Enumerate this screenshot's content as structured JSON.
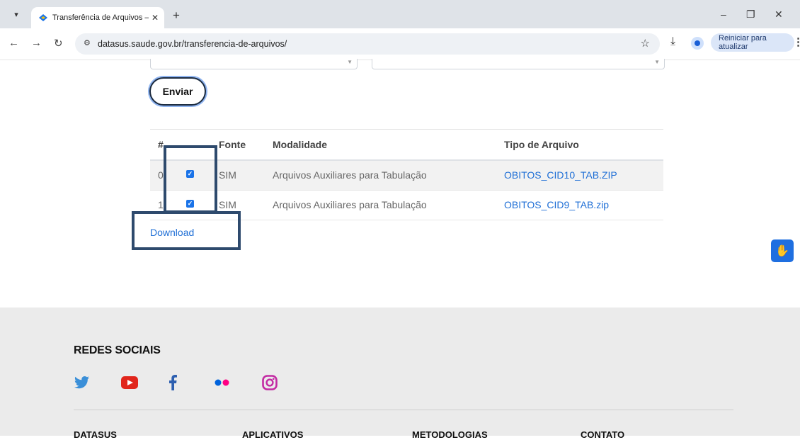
{
  "browser": {
    "tab_title": "Transferência de Arquivos – DA",
    "url": "datasus.saude.gov.br/transferencia-de-arquivos/",
    "restart_label": "Reiniciar para atualizar"
  },
  "form": {
    "submit_label": "Enviar"
  },
  "table": {
    "headers": {
      "index": "#",
      "fonte": "Fonte",
      "modalidade": "Modalidade",
      "tipo": "Tipo de Arquivo"
    },
    "rows": [
      {
        "index": "0",
        "checked": true,
        "fonte": "SIM",
        "modalidade": "Arquivos Auxiliares para Tabulação",
        "arquivo": "OBITOS_CID10_TAB.ZIP"
      },
      {
        "index": "1",
        "checked": true,
        "fonte": "SIM",
        "modalidade": "Arquivos Auxiliares para Tabulação",
        "arquivo": "OBITOS_CID9_TAB.zip"
      }
    ]
  },
  "download_label": "Download",
  "footer": {
    "social_heading": "REDES SOCIAIS",
    "social_icons": [
      "twitter-icon",
      "youtube-icon",
      "facebook-icon",
      "flickr-icon",
      "instagram-icon"
    ],
    "columns": [
      "DATASUS",
      "APLICATIVOS",
      "METODOLOGIAS",
      "CONTATO"
    ]
  },
  "colors": {
    "link": "#1f6fd6",
    "checkbox": "#1a73e8",
    "highlight": "#2e4a6d",
    "footer_bg": "#ebebeb"
  }
}
